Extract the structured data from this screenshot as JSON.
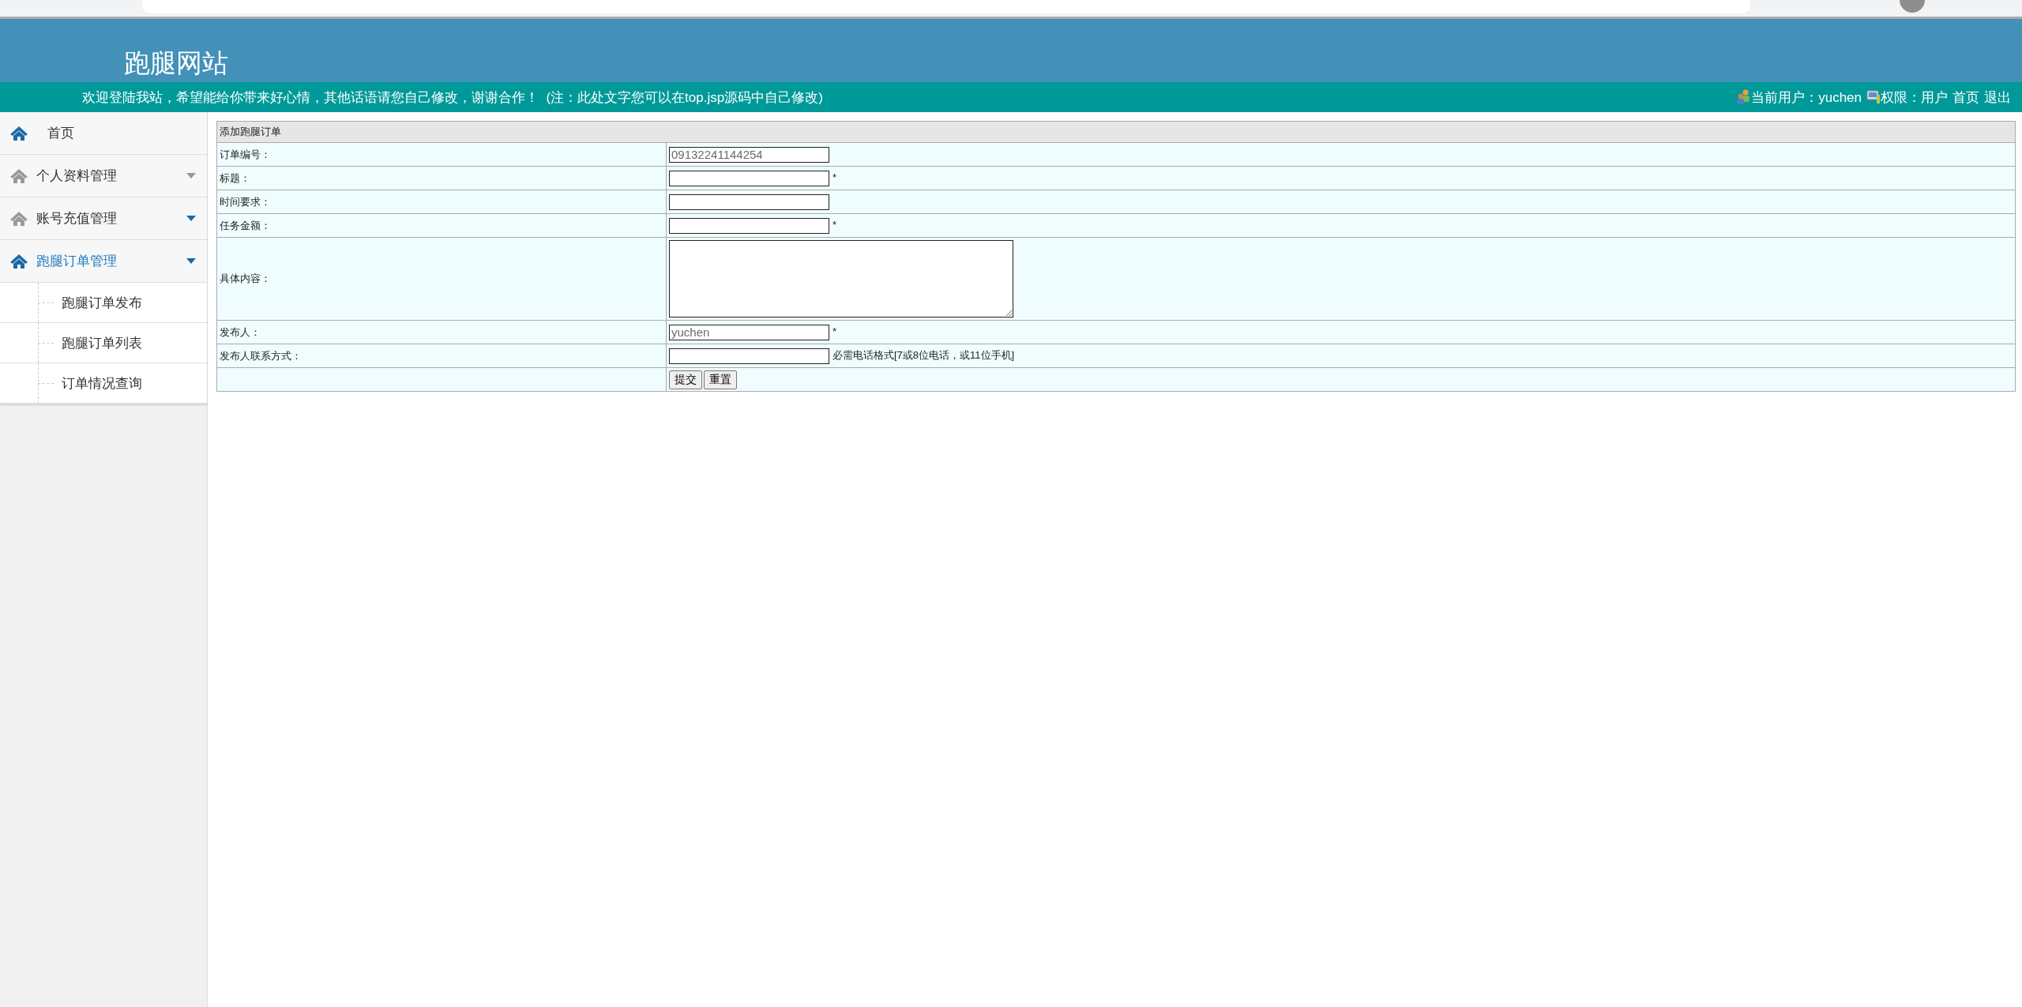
{
  "site_title": "跑腿网站",
  "notice": "欢迎登陆我站，希望能给你带来好心情，其他话语请您自己修改，谢谢合作！  (注：此处文字您可以在top.jsp源码中自己修改)",
  "user_bar": {
    "current_user": "当前用户：yuchen",
    "permission": "权限：用户",
    "links": [
      "首页",
      "退出"
    ]
  },
  "sidebar": {
    "items": [
      {
        "kind": "link",
        "label": "首页",
        "icon_active": true,
        "selected": false
      },
      {
        "kind": "group",
        "label": "个人资料管理",
        "icon_active": false,
        "selected": false,
        "caret_active": false
      },
      {
        "kind": "group",
        "label": "账号充值管理",
        "icon_active": false,
        "selected": false,
        "caret_active": true
      },
      {
        "kind": "group",
        "label": "跑腿订单管理",
        "icon_active": true,
        "selected": true,
        "caret_active": true,
        "children": [
          {
            "label": "跑腿订单发布"
          },
          {
            "label": "跑腿订单列表"
          },
          {
            "label": "订单情况查询"
          }
        ]
      }
    ]
  },
  "form": {
    "title": "添加跑腿订单",
    "rows": [
      {
        "kind": "text",
        "label": "订单编号：",
        "value": "09132241144254",
        "readonly": true
      },
      {
        "kind": "text",
        "label": "标题：",
        "note": "*"
      },
      {
        "kind": "text",
        "label": "时间要求："
      },
      {
        "kind": "text",
        "label": "任务金额：",
        "note": "*"
      },
      {
        "kind": "textarea",
        "label": "具体内容："
      },
      {
        "kind": "text",
        "label": "发布人：",
        "value": "yuchen",
        "readonly": true,
        "note": "*"
      },
      {
        "kind": "text",
        "label": "发布人联系方式：",
        "note": "必需电话格式[7或8位电话，或11位手机]"
      },
      {
        "kind": "buttons",
        "buttons": [
          "提交",
          "重置"
        ]
      }
    ]
  }
}
